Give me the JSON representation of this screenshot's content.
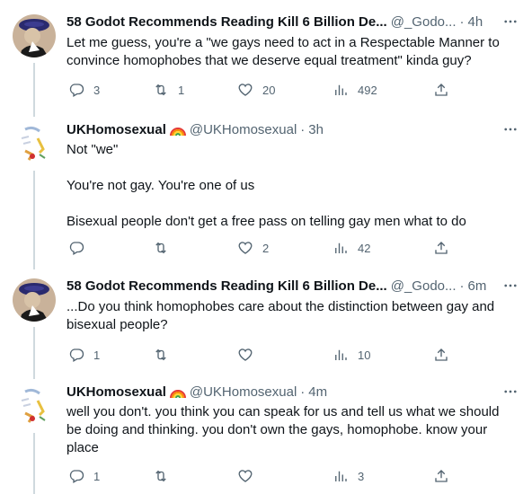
{
  "tweets": [
    {
      "name": "58 Godot Recommends Reading Kill 6 Billion De...",
      "handle": "@_Godo...",
      "time": "4h",
      "text": "Let me guess, you're a \"we gays need to act in a Respectable Manner to convince homophobes that we deserve equal treatment\" kinda guy?",
      "replies": "3",
      "retweets": "1",
      "likes": "20",
      "views": "492"
    },
    {
      "name": "UKHomosexual",
      "handle": "@UKHomosexual",
      "time": "3h",
      "text": "Not \"we\"\n\nYou're not gay. You're one of us\n\nBisexual people don't get a free pass on telling gay men what to do",
      "replies": "",
      "retweets": "",
      "likes": "2",
      "views": "42"
    },
    {
      "name": "58 Godot Recommends Reading Kill 6 Billion De...",
      "handle": "@_Godo...",
      "time": "6m",
      "text": "...Do you think homophobes care about the distinction between gay and bisexual people?",
      "replies": "1",
      "retweets": "",
      "likes": "",
      "views": "10"
    },
    {
      "name": "UKHomosexual",
      "handle": "@UKHomosexual",
      "time": "4m",
      "text": "well you don't. you think you can speak for us and tell us what we should be doing and thinking. you don't own the gays, homophobe. know your place",
      "replies": "1",
      "retweets": "",
      "likes": "",
      "views": "3"
    }
  ],
  "icons": {
    "verified_emoji": "rainbow-icon",
    "more": "more-icon",
    "reply": "reply-icon",
    "retweet": "retweet-icon",
    "like": "heart-icon",
    "views": "views-icon",
    "share": "share-icon"
  },
  "colors": {
    "text": "#0f1419",
    "secondary": "#536471",
    "thread_line": "#cfd9de"
  }
}
